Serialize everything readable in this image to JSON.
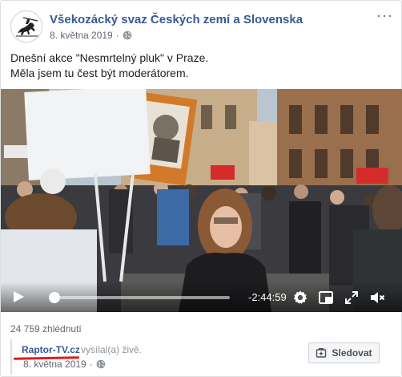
{
  "post": {
    "page_name": "Všekozácký svaz Českých zemí a Slovenska",
    "date": "8. května 2019",
    "privacy_icon": "globe-icon",
    "text_lines": [
      "Dnešní akce \"Nesmrtelný pluk\" v Praze.",
      "Měla jsem tu čest být moderátorem."
    ]
  },
  "video": {
    "time_remaining": "-2:44:59",
    "progress": 0.03,
    "controls": [
      "play-icon",
      "settings-icon",
      "picture-in-picture-icon",
      "fullscreen-icon",
      "volume-muted-icon"
    ]
  },
  "stats": {
    "views": "24 759 zhlédnutí"
  },
  "shared_from": {
    "name": "Raptor-TV.cz",
    "action": "vysílal(a) živě.",
    "date": "8. května 2019",
    "follow_label": "Sledovat",
    "underline_color": "#e21b1b"
  },
  "colors": {
    "link": "#385898",
    "muted": "#616770"
  }
}
